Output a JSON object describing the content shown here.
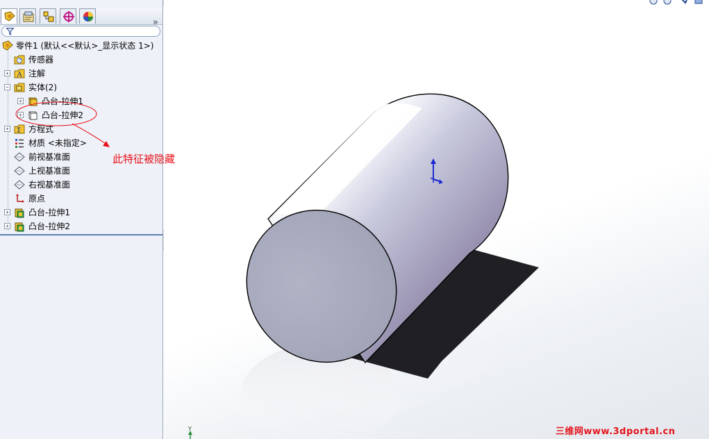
{
  "panel": {
    "expand_glyph": "»",
    "tabs": [
      {
        "icon": "feature-manager-icon",
        "active": true
      },
      {
        "icon": "property-manager-icon",
        "active": false
      },
      {
        "icon": "configuration-manager-icon",
        "active": false
      },
      {
        "icon": "dimxpert-manager-icon",
        "active": false
      },
      {
        "icon": "display-manager-icon",
        "active": false
      }
    ]
  },
  "tree": {
    "root_label": "零件1 (默认<<默认>_显示状态 1>)",
    "items": [
      {
        "label": "传感器",
        "icon": "sensor-folder-icon"
      },
      {
        "label": "注解",
        "icon": "annotation-folder-icon"
      },
      {
        "label": "实体(2)",
        "icon": "solid-bodies-folder-icon"
      },
      {
        "label": "凸台-拉伸1",
        "icon": "solid-body-icon"
      },
      {
        "label": "凸台-拉伸2",
        "icon": "hidden-body-icon"
      },
      {
        "label": "方程式",
        "icon": "equations-folder-icon"
      },
      {
        "label": "材质 <未指定>",
        "icon": "material-icon"
      },
      {
        "label": "前视基准面",
        "icon": "plane-icon"
      },
      {
        "label": "上视基准面",
        "icon": "plane-icon"
      },
      {
        "label": "右视基准面",
        "icon": "plane-icon"
      },
      {
        "label": "原点",
        "icon": "origin-icon"
      },
      {
        "label": "凸台-拉伸1",
        "icon": "extrude-feature-icon"
      },
      {
        "label": "凸台-拉伸2",
        "icon": "extrude-feature-icon"
      }
    ]
  },
  "annotation": {
    "text": "此特征被隐藏",
    "color": "#e8101a"
  },
  "viewport": {
    "triad_y_label": "Y"
  },
  "watermark": "三维网www.3dportal.cn",
  "colors": {
    "selection_rule": "#5b7fb0",
    "folder_yellow": "#f2c531",
    "annotation_red": "#e8101a"
  }
}
